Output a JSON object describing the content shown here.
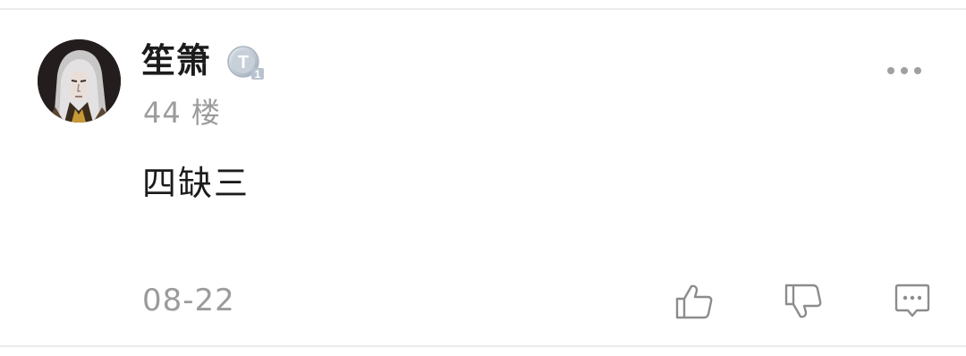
{
  "comment": {
    "username": "笙箫",
    "floor": "44 楼",
    "content": "四缺三",
    "date": "08-22",
    "level_badge_letter": "T",
    "level_badge_number": "1"
  },
  "icons": {
    "avatar": "avatar",
    "level_badge": "level-badge-icon",
    "more": "more-dots-icon",
    "like": "thumbs-up-icon",
    "dislike": "thumbs-down-icon",
    "reply": "comment-icon"
  },
  "colors": {
    "text_primary": "#1c1c1c",
    "text_secondary": "#9b9b9b",
    "icon_gray": "#8c8c8c",
    "divider": "#ececec",
    "badge_silver": "#b9c3cf"
  }
}
